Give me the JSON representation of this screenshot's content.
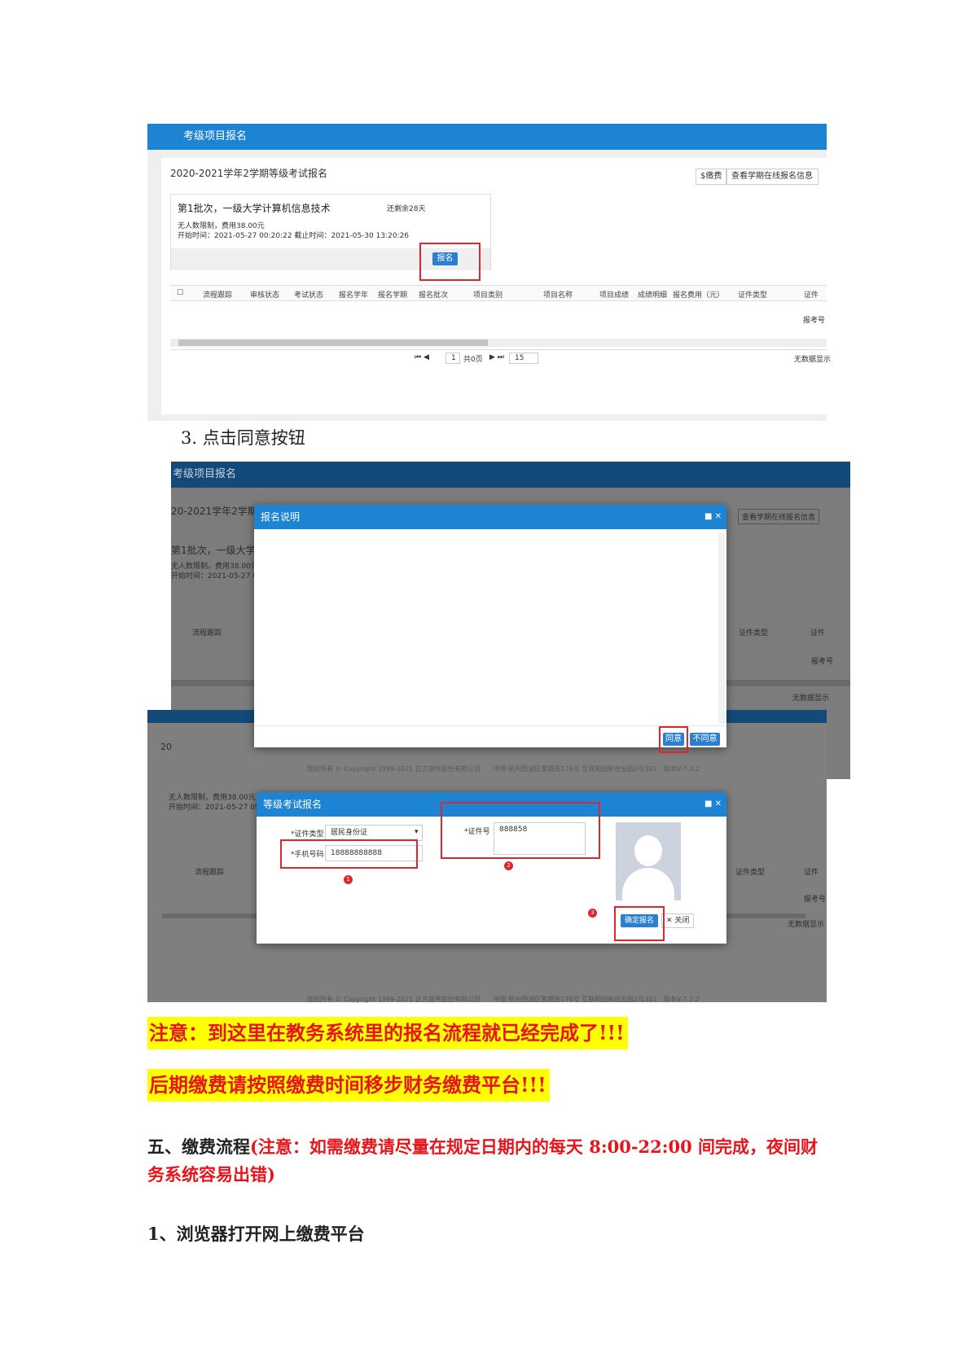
{
  "screenshot1": {
    "header_title": "考级项目报名",
    "panel_title": "2020-2021学年2学期等级考试报名",
    "btn_view": "$缴费",
    "btn_info": "查看学期在线报名信息",
    "card": {
      "title": "第1批次，一级大学计算机信息技术",
      "remaining": "还剩余28天",
      "limit": "无人数限制，费用38.00元",
      "time": "开始时间：2021-05-27 00:20:22 截止时间：2021-05-30 13:20:26",
      "signup_button": "报名"
    },
    "columns": [
      "流程跟踪",
      "审核状态",
      "考试状态",
      "报名学年",
      "报名学期",
      "报名批次",
      "项目类别",
      "项目名称",
      "项目成绩",
      "成绩明细",
      "报名费用（元）",
      "证件类型",
      "证件"
    ],
    "row_tail": "报考号",
    "pager": {
      "page": "1",
      "total": "共0页",
      "page_size": "15",
      "empty": "无数据显示"
    }
  },
  "caption": "3.  点击同意按钮",
  "screenshot2": {
    "bg_header": "考级项目报名",
    "bg_panel_title": "20-2021学年2学期等",
    "bg_card_title": "第1批次，一级大学计",
    "bg_limit": "无人数限制，费用38.00元",
    "bg_time": "开始时间：2021-05-27 09",
    "bg_col1": "流程跟踪",
    "bg_col_cert": "证件类型",
    "bg_col_cert2": "证件",
    "bg_row_tail": "报考号",
    "bg_empty": "无数据显示",
    "bg_footer": "版权所有 © Copyright 1999-2021 正方软件股份有限公司　　中国·杭州西湖区紫霞街176号 互联网创新创业园2号301　版本V-7.2.2",
    "bg_year": "20",
    "bg_btn_info": "查看学期在线报名信息",
    "dialog1": {
      "title": "报名说明",
      "controls": "■ ✕",
      "agree": "同意",
      "disagree": "不同意"
    },
    "dialog2": {
      "title": "等级考试报名",
      "controls": "■ ✕",
      "cert_type_label": "*证件类型",
      "cert_type_value": "居民身份证",
      "phone_label": "*手机号码",
      "phone_value": "18888888888",
      "cert_no_label": "*证件号",
      "cert_no_value": "888858",
      "confirm": "确定报名",
      "close": "关闭",
      "close_icon": "✕"
    },
    "markers": [
      "1",
      "2",
      "3"
    ]
  },
  "notes": [
    "注意：到这里在教务系统里的报名流程就已经完成了!!!",
    "后期缴费请按照缴费时间移步财务缴费平台!!!"
  ],
  "section": {
    "title": "五、缴费流程",
    "note": "(注意：如需缴费请尽量在规定日期内的每天 8:00-22:00 间完成，夜间财务系统容易出错)"
  },
  "step1": "1、浏览器打开网上缴费平台"
}
